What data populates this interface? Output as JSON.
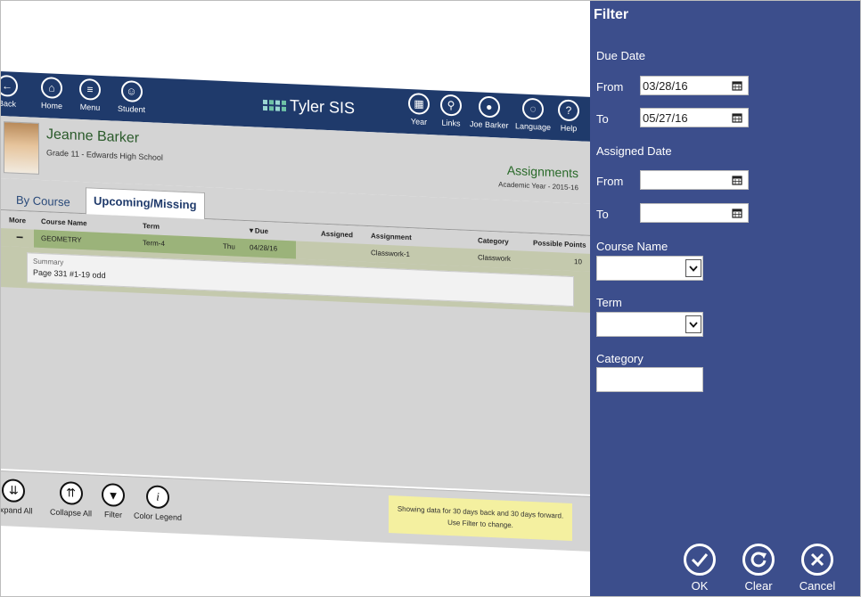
{
  "app": {
    "nav": [
      {
        "label": "Back",
        "icon": "back-arrow-icon",
        "glyph": "←"
      },
      {
        "label": "Home",
        "icon": "home-icon",
        "glyph": "⌂"
      },
      {
        "label": "Menu",
        "icon": "menu-icon",
        "glyph": "≡"
      },
      {
        "label": "Student",
        "icon": "student-icon",
        "glyph": "☺"
      }
    ],
    "logo_text": "Tyler SIS",
    "right_nav": [
      {
        "label": "Year",
        "icon": "calendar-icon",
        "glyph": "▦"
      },
      {
        "label": "Links",
        "icon": "link-icon",
        "glyph": "⚲"
      },
      {
        "label": "Joe Barker",
        "icon": "user-icon",
        "glyph": "●"
      },
      {
        "label": "Language",
        "icon": "speech-bubble-icon",
        "glyph": "💬"
      },
      {
        "label": "Help",
        "icon": "help-icon",
        "glyph": "?"
      }
    ],
    "student": {
      "name": "Jeanne Barker",
      "grade": "Grade 11 - Edwards High School"
    },
    "page_title": "Assignments",
    "academic_year": "Academic Year - 2015-16",
    "tabs": [
      {
        "label": "By Course"
      },
      {
        "label": "Upcoming/Missing"
      }
    ],
    "columns": [
      "More",
      "Course Name",
      "Term",
      "▼Due",
      "Assigned",
      "Assignment",
      "Category",
      "Possible Points"
    ],
    "row": {
      "expander": "−",
      "course": "GEOMETRY",
      "term": "Term-4",
      "due_day": "Thu",
      "due_date": "04/28/16",
      "assignment": "Classwork-1",
      "category": "Classwork",
      "points": "10"
    },
    "summary": {
      "label": "Summary",
      "text": "Page 331 #1-19 odd"
    },
    "bottom": [
      {
        "label": "Expand All",
        "glyph": "⇊"
      },
      {
        "label": "Collapse All",
        "glyph": "⇈"
      },
      {
        "label": "Filter",
        "glyph": "▼"
      },
      {
        "label": "Color Legend",
        "glyph": "i"
      }
    ],
    "notice_line1": "Showing data for 30 days back and 30 days forward.",
    "notice_line2": "Use Filter to change."
  },
  "filter": {
    "title": "Filter",
    "due_date": {
      "heading": "Due Date",
      "from_label": "From",
      "from_value": "03/28/16",
      "to_label": "To",
      "to_value": "05/27/16"
    },
    "assigned_date": {
      "heading": "Assigned Date",
      "from_label": "From",
      "from_value": "",
      "to_label": "To",
      "to_value": ""
    },
    "course_name": {
      "label": "Course Name",
      "value": ""
    },
    "term": {
      "label": "Term",
      "value": ""
    },
    "category": {
      "label": "Category",
      "value": ""
    },
    "actions": [
      {
        "label": "OK"
      },
      {
        "label": "Clear"
      },
      {
        "label": "Cancel"
      }
    ]
  },
  "colors": {
    "filter_panel": "#3c4e8c",
    "app_header": "#1f3a6b",
    "row_highlight": "#9bb37a",
    "notice": "#f4f0a0"
  }
}
